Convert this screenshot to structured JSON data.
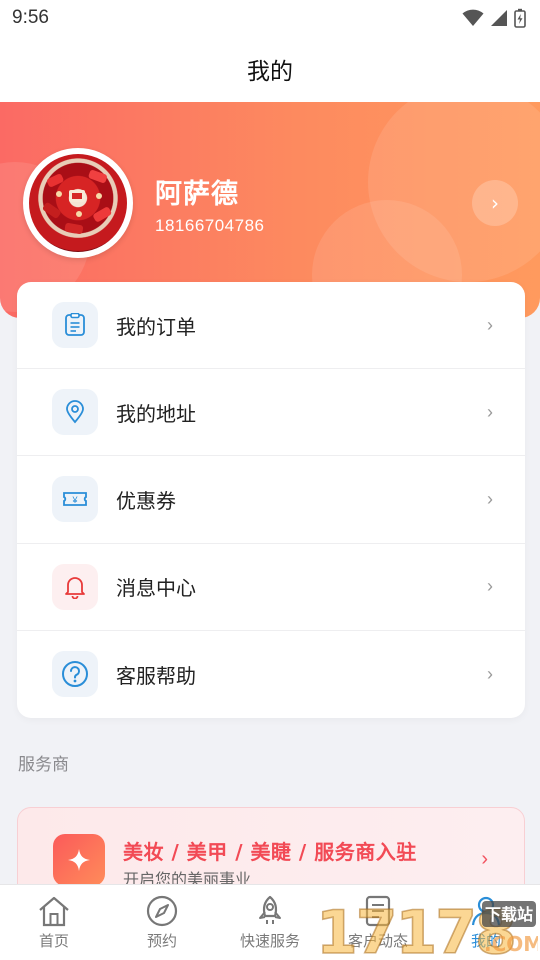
{
  "status_bar": {
    "time": "9:56"
  },
  "header": {
    "title": "我的"
  },
  "profile": {
    "name": "阿萨德",
    "phone": "18166704786"
  },
  "menu": [
    {
      "label": "我的订单",
      "icon": "order-list-icon"
    },
    {
      "label": "我的地址",
      "icon": "location-pin-icon"
    },
    {
      "label": "优惠券",
      "icon": "coupon-icon"
    },
    {
      "label": "消息中心",
      "icon": "bell-icon"
    },
    {
      "label": "客服帮助",
      "icon": "help-circle-icon"
    }
  ],
  "provider_section": {
    "label": "服务商",
    "promo_title": "美妆 / 美甲 / 美睫 / 服务商入驻",
    "promo_subtitle": "开启您的美丽事业"
  },
  "tabbar": [
    {
      "label": "首页",
      "icon": "home-icon",
      "active": false
    },
    {
      "label": "预约",
      "icon": "compass-icon",
      "active": false
    },
    {
      "label": "快速服务",
      "icon": "rocket-icon",
      "active": false
    },
    {
      "label": "客户动态",
      "icon": "document-icon",
      "active": false
    },
    {
      "label": "我的",
      "icon": "user-icon",
      "active": true
    }
  ],
  "watermark": {
    "text": "17178",
    "sub": "下载站",
    "domain": ".COM"
  },
  "colors": {
    "accent": "#2a8ed8",
    "hero_start": "#fb6a64",
    "hero_end": "#ff9a5e",
    "promo_text": "#f24a55"
  }
}
